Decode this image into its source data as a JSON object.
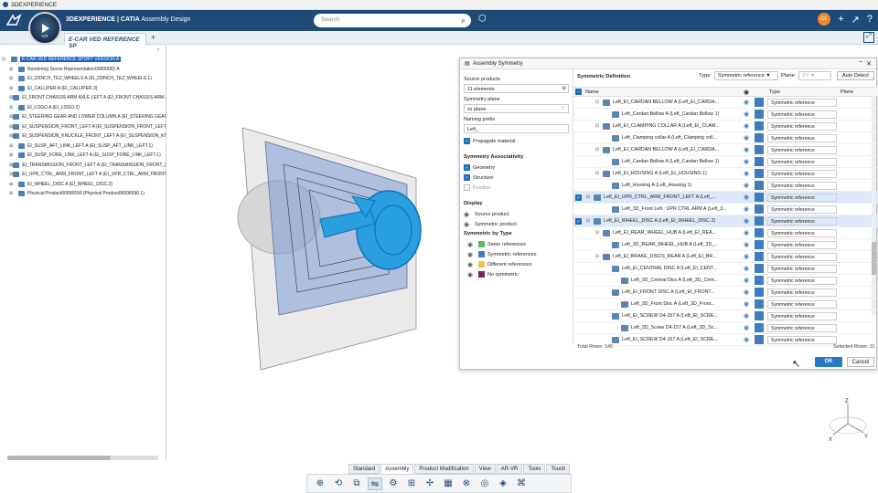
{
  "os": {
    "title": "3DEXPERIENCE"
  },
  "header": {
    "brand_bold": "3DEXPERIENCE",
    "brand_app": " | CATIA",
    "brand_module": "Assembly Design",
    "compass_label": "V,R",
    "search_placeholder": "Search",
    "avatar": "CE"
  },
  "tabs": {
    "doc_tab": "E-CAR VED REFERENCE SP",
    "plus": "+"
  },
  "tree": {
    "items": [
      "E-CAR VED REFERENCE SPORT VERSION A",
      "Rendering Scene Representation00000002 A",
      "EI_22INCH_TEZ_WHEELS A (EI_22INCH_TEZ_WHEELS.1)",
      "EI_CALLIPER A (EI_CALLIPER.3)",
      "EI_FRONT CHASSIS ARM AXLE LEFT A (EI_FRONT CHASSIS ARM A",
      "EI_LOGO A (EI_LOGO.2)",
      "EI_STEERING GEAR AND LOWER COLUMN A (EI_STEERING GEAR",
      "EI_SUSPENSION_FRONT_LEFT A (EI_SUSPENSION_FRONT_LEFT.1)",
      "EI_SUSPENSION_KNUCKLE_FRONT_LEFT A (EI_SUSPENSION_KNU",
      "EI_SUSP_AFT_LINK_LEFT A (EI_SUSP_AFT_LINK_LEFT.1)",
      "EI_SUSP_FORE_LINK_LEFT A (EI_SUSP_FORE_LINK_LEFT.1)",
      "EI_TRANSMISSION_FRONT_LEFT A (EI_TRANSMISSION_FRONT_LE",
      "EI_UPR_CTRL_ARM_FRONT_LEFT A (EI_UPR_CTRL_ARM_FRONT_LE",
      "EI_WHEEL_DISC A (EI_WHEEL_DISC.2)",
      "Physical Product00006590 (Physical Product00006590.1)"
    ]
  },
  "dialog": {
    "title": "Assembly Symmetry",
    "source_products_label": "Source products",
    "source_products_value": "11 elements",
    "symmetry_plane_label": "Symmetry plane",
    "symmetry_plane_value": "zx plane",
    "naming_prefix_label": "Naming prefix",
    "naming_prefix_value": "Left_",
    "propagate_material": "Propagate material",
    "associativity_title": "Symmetry Associativity",
    "geometry": "Geometry",
    "structure": "Structure",
    "position": "Position",
    "display_title": "Display",
    "source_product": "Source product",
    "symmetric_product": "Symmetric product",
    "by_type_title": "Symmetric by Type",
    "same_refs": "Same references",
    "sym_refs": "Symmetric references",
    "diff_refs": "Different references",
    "no_sym": "No symmetric",
    "colors": {
      "same": "#5cb85c",
      "sym": "#3f7bbf",
      "diff": "#f0c34a",
      "none": "#7a1f6e"
    },
    "def_title": "Symmetric Definition",
    "type_label": "Type",
    "type_value": "Symmetric reference",
    "plane_label": "Plane",
    "plane_value": "XY",
    "auto_detect": "Auto Detect",
    "col_name": "Name",
    "col_type": "Type",
    "col_plane": "Plane",
    "total_rows": "Total Rows: 145",
    "selected_rows": "Selected Rows: 11",
    "ok": "OK",
    "cancel": "Cancel",
    "rows": [
      {
        "name": "Left_EI_CARDAN BELLOW A (Left_EI_CARDA...",
        "lvl": 1,
        "chk": false,
        "hl": false
      },
      {
        "name": "Left_Cardan Bellow A (Left_Cardan Bellow 1)",
        "lvl": 2,
        "chk": false,
        "hl": false
      },
      {
        "name": "Left_EI_CLAMPING COLLAR A (Left_EI_CLAM...",
        "lvl": 1,
        "chk": false,
        "hl": false
      },
      {
        "name": "Left_Clamping collar A (Left_Clamping coll...",
        "lvl": 2,
        "chk": false,
        "hl": false
      },
      {
        "name": "Left_EI_CARDAN BELLOW A (Left_EI_CARDA...",
        "lvl": 1,
        "chk": false,
        "hl": false
      },
      {
        "name": "Left_Cardan Bellow A (Left_Cardan Bellow 1)",
        "lvl": 2,
        "chk": false,
        "hl": false
      },
      {
        "name": "Left_EI_HOUSING A (Left_EI_HOUSING.1)",
        "lvl": 1,
        "chk": false,
        "hl": false
      },
      {
        "name": "Left_Housing A (Left_Housing 1)",
        "lvl": 2,
        "chk": false,
        "hl": false
      },
      {
        "name": "Left_EI_UPR_CTRL_ARM_FRONT_LEFT A (Left_...",
        "lvl": 0,
        "chk": true,
        "hl": true
      },
      {
        "name": "Left_3D_Front Left : UPR CTRL ARM A (Left_3...",
        "lvl": 2,
        "chk": false,
        "hl": false
      },
      {
        "name": "Left_EI_WHEEL_DISC A (Left_EI_WHEEL_DISC.2)",
        "lvl": 0,
        "chk": true,
        "hl": true
      },
      {
        "name": "Left_EI_REAR_WHEEL_HUB A (Left_EI_REA...",
        "lvl": 1,
        "chk": false,
        "hl": false
      },
      {
        "name": "Left_3D_REAR_WHEEL_HUB A (Left_3D_...",
        "lvl": 2,
        "chk": false,
        "hl": false
      },
      {
        "name": "Left_EI_BRAKE_DISCS_REAR A (Left_EI_BR...",
        "lvl": 1,
        "chk": false,
        "hl": false
      },
      {
        "name": "Left_EI_CENTRAL DISC A (Left_EI_CENT...",
        "lvl": 2,
        "chk": false,
        "hl": false
      },
      {
        "name": "Left_3D_Central Disc A (Left_3D_Cent...",
        "lvl": 3,
        "chk": false,
        "hl": false
      },
      {
        "name": "Left_EI_FRONT DISC A (Left_EI_FRONT...",
        "lvl": 2,
        "chk": false,
        "hl": false
      },
      {
        "name": "Left_3D_Front Disc A (Left_3D_Front...",
        "lvl": 3,
        "chk": false,
        "hl": false
      },
      {
        "name": "Left_EI_SCREW D4-157 A (Left_EI_SCRE...",
        "lvl": 2,
        "chk": false,
        "hl": false
      },
      {
        "name": "Left_3D_Screw D4-157 A (Left_3D_Sc...",
        "lvl": 3,
        "chk": false,
        "hl": false
      },
      {
        "name": "Left_EI_SCREW D4-157 A (Left_EI_SCRE...",
        "lvl": 2,
        "chk": false,
        "hl": false
      }
    ]
  },
  "bottom_tabs": [
    "Standard",
    "Assembly",
    "Product Modification",
    "View",
    "AR-VR",
    "Tools",
    "Touch"
  ],
  "bottom_tab_active": "Assembly",
  "axes": {
    "z": "Z",
    "x": "X",
    "y": "Y"
  }
}
